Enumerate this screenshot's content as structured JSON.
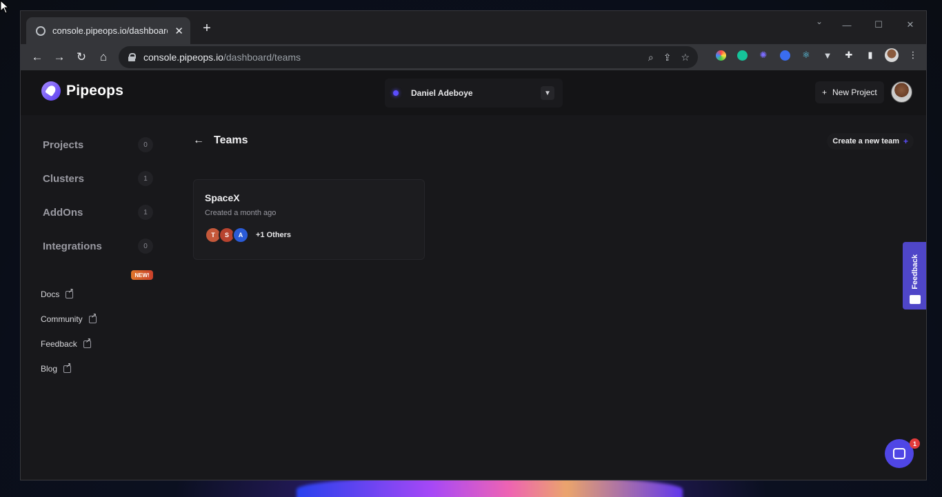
{
  "browser": {
    "tab_title": "console.pipeops.io/dashboard/te",
    "url_host": "console.pipeops.io",
    "url_path": "/dashboard/teams"
  },
  "app": {
    "brand": "Pipeops",
    "account_name": "Daniel Adeboye",
    "new_project_label": "New Project"
  },
  "sidebar": {
    "items": [
      {
        "label": "Projects",
        "count": "0"
      },
      {
        "label": "Clusters",
        "count": "1"
      },
      {
        "label": "AddOns",
        "count": "1"
      },
      {
        "label": "Integrations",
        "count": "0"
      }
    ],
    "links": [
      {
        "label": "Docs"
      },
      {
        "label": "Community",
        "badge": "NEW!"
      },
      {
        "label": "Feedback"
      },
      {
        "label": "Blog"
      }
    ]
  },
  "main": {
    "page_title": "Teams",
    "create_team_label": "Create a new team",
    "teams": [
      {
        "name": "SpaceX",
        "created": "Created a month ago",
        "members": [
          {
            "initial": "T",
            "color": "#c4583a"
          },
          {
            "initial": "S",
            "color": "#b8432f"
          },
          {
            "initial": "A",
            "color": "#2a5bd7"
          }
        ],
        "others": "+1 Others"
      }
    ]
  },
  "widgets": {
    "feedback_tab": "Feedback",
    "chat_unread": "1"
  },
  "colors": {
    "accent": "#5b4dff",
    "feedback_bg": "#4f46c8"
  }
}
